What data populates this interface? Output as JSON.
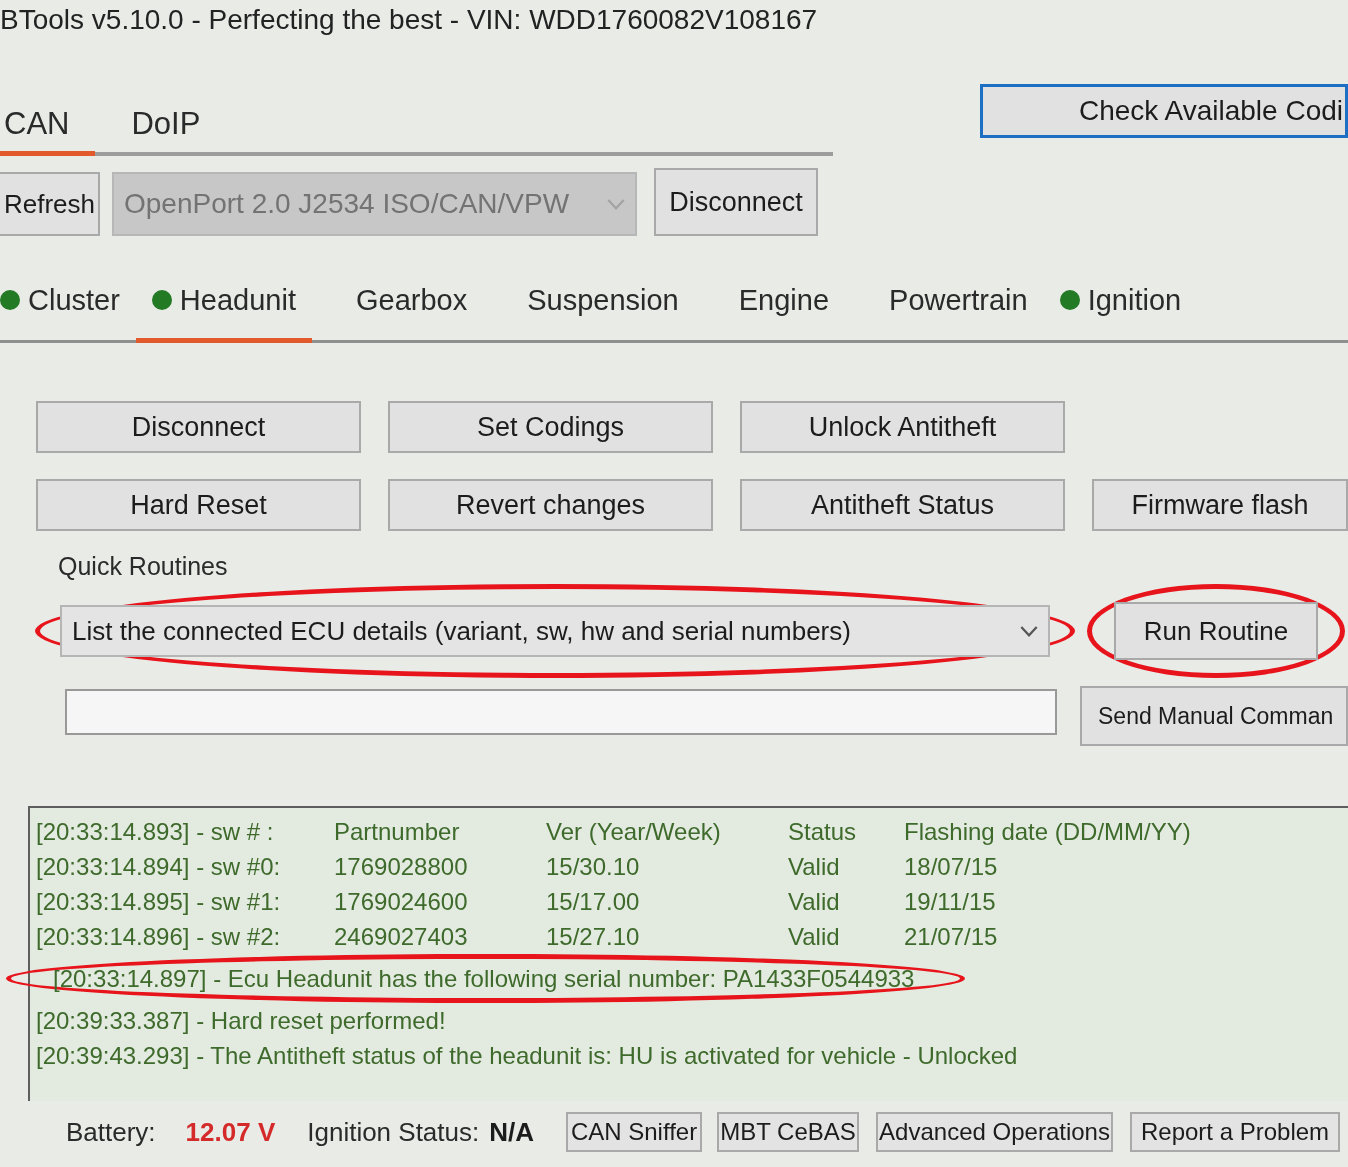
{
  "window": {
    "title": "BTools v5.10.0 - Perfecting the best - VIN: WDD1760082V108167"
  },
  "protocol_tabs": [
    {
      "label": "CAN",
      "selected": true
    },
    {
      "label": "DoIP",
      "selected": false
    }
  ],
  "check_codings_button": {
    "label": "Check Available Codi",
    "focused": true
  },
  "connection": {
    "refresh_button": "Refresh",
    "device": {
      "value": "OpenPort 2.0 J2534 ISO/CAN/VPW",
      "disabled": true
    },
    "disconnect_button": "Disconnect"
  },
  "ecu_tabs": [
    {
      "label": "Cluster",
      "indicator": true,
      "selected": false
    },
    {
      "label": "Headunit",
      "indicator": true,
      "selected": true
    },
    {
      "label": "Gearbox",
      "indicator": false,
      "selected": false
    },
    {
      "label": "Suspension",
      "indicator": false,
      "selected": false
    },
    {
      "label": "Engine",
      "indicator": false,
      "selected": false
    },
    {
      "label": "Powertrain",
      "indicator": false,
      "selected": false
    },
    {
      "label": "Ignition",
      "indicator": true,
      "selected": false
    }
  ],
  "action_rows": [
    [
      "Disconnect",
      "Set Codings",
      "Unlock Antitheft"
    ],
    [
      "Hard Reset",
      "Revert changes",
      "Antitheft Status",
      "Firmware flash"
    ]
  ],
  "quick_routines": {
    "label": "Quick Routines",
    "value": "List the connected ECU details (variant, sw, hw and serial numbers)",
    "circled": true,
    "run_button": {
      "label": "Run Routine",
      "circled": true
    }
  },
  "manual_command": {
    "button": "Send Manual Comman"
  },
  "log": [
    {
      "kind": "columns",
      "cells": [
        "[20:33:14.893] - sw # :",
        "Partnumber",
        "Ver (Year/Week)",
        "Status",
        "Flashing date (DD/MM/YY)"
      ],
      "circled": false
    },
    {
      "kind": "columns",
      "cells": [
        "[20:33:14.894] - sw #0:",
        "1769028800",
        "15/30.10",
        "Valid",
        "18/07/15"
      ],
      "circled": false
    },
    {
      "kind": "columns",
      "cells": [
        "[20:33:14.895] - sw #1:",
        "1769024600",
        "15/17.00",
        "Valid",
        "19/11/15"
      ],
      "circled": false
    },
    {
      "kind": "columns",
      "cells": [
        "[20:33:14.896] - sw #2:",
        "2469027403",
        "15/27.10",
        "Valid",
        "21/07/15"
      ],
      "circled": false
    },
    {
      "kind": "message",
      "text": "[20:33:14.897] - Ecu Headunit has the following serial number: PA1433F0544933",
      "circled": true
    },
    {
      "kind": "message",
      "text": "[20:39:33.387] - Hard reset performed!",
      "circled": false
    },
    {
      "kind": "message",
      "text": "[20:39:43.293] - The Antitheft status of the headunit is: HU is activated for vehicle - Unlocked",
      "circled": false
    }
  ],
  "status_bar": {
    "battery_label": "Battery:",
    "battery_value": "12.07 V",
    "ignition_label": "Ignition Status:",
    "ignition_value": "N/A",
    "buttons": [
      "CAN Sniffer",
      "MBT CeBAS",
      "Advanced Operations",
      "Report a Problem"
    ]
  }
}
